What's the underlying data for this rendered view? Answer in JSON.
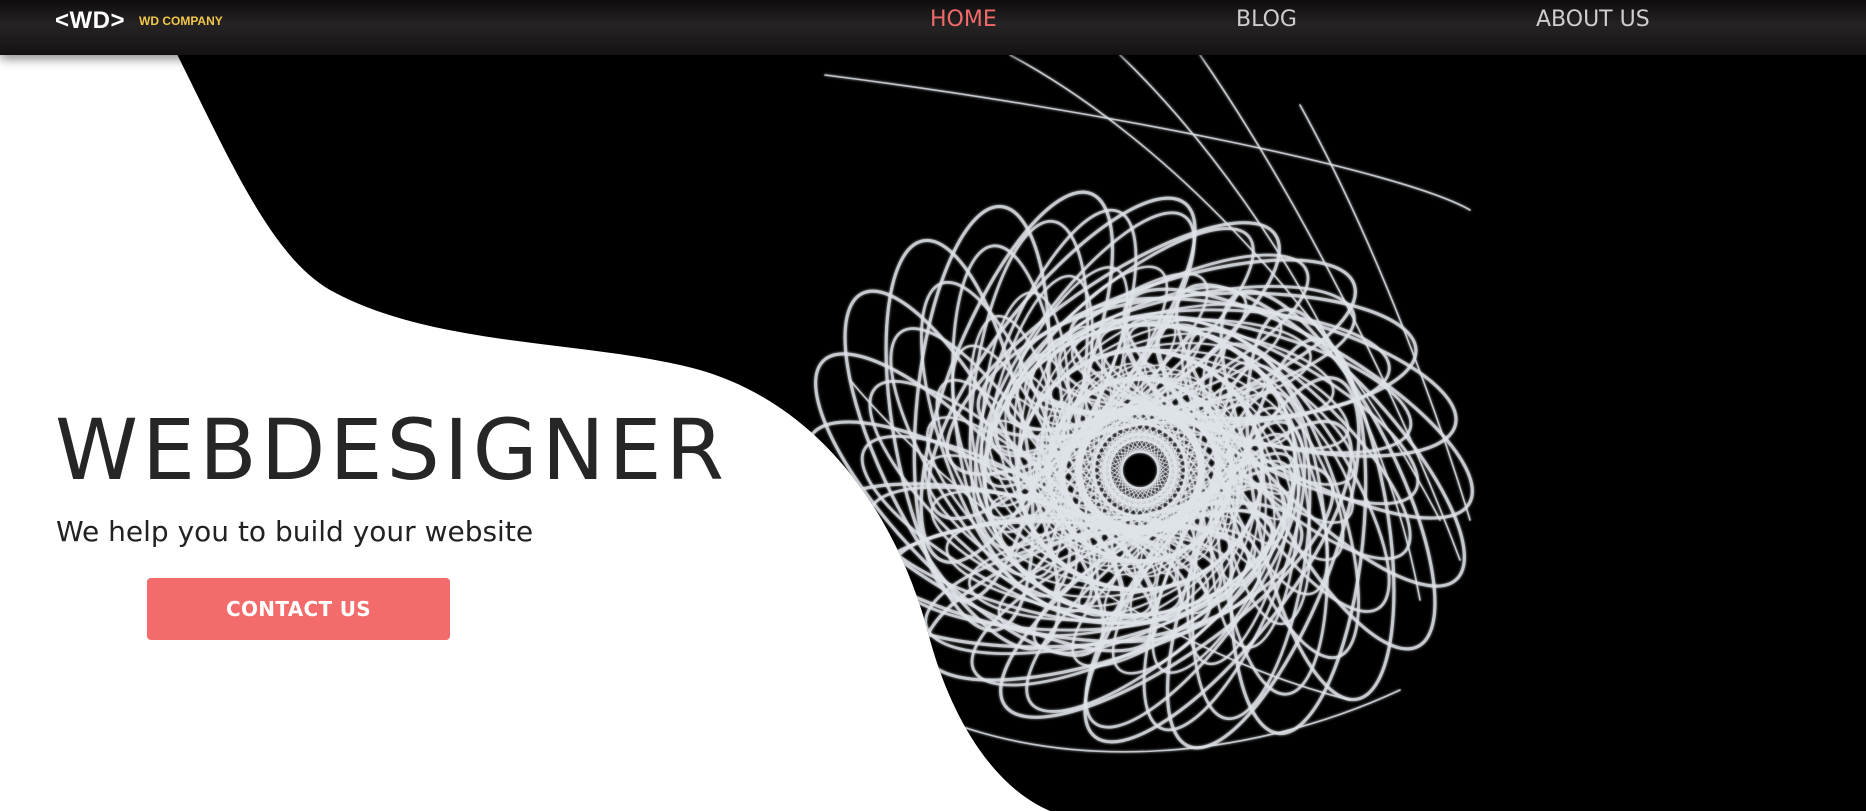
{
  "nav": {
    "logo": "<WD>",
    "company": "WD COMPANY",
    "links": [
      {
        "label": "HOME",
        "active": true
      },
      {
        "label": "BLOG",
        "active": false
      },
      {
        "label": "ABOUT US",
        "active": false
      }
    ]
  },
  "hero": {
    "title": "WEBDESIGNER",
    "subtitle": "We help you to build your website",
    "cta_label": "CONTACT US"
  },
  "colors": {
    "accent": "#f36b6b",
    "nav_active": "#f06a6a",
    "logo_company": "#f2c84b",
    "hero_dark": "#000000"
  }
}
